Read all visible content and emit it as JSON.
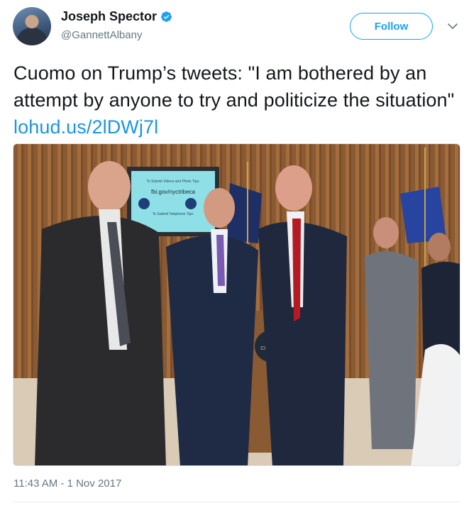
{
  "author": {
    "name": "Joseph Spector",
    "handle": "@GannettAlbany",
    "verified": true
  },
  "follow_label": "Follow",
  "icons": {
    "verified": "verified-badge-icon",
    "caret": "chevron-down-icon"
  },
  "tweet": {
    "text": "Cuomo on Trump’s tweets: \"I am bothered by an attempt by anyone to try and politicize the situation\"",
    "link": "lohud.us/2lDWj7l"
  },
  "photo": {
    "screen_text_1": "To Submit Videos and Photo Tips:",
    "screen_text_2": "fbi.gov/nyctribeca",
    "screen_text_3": "To Submit Telephone Tips:",
    "seal_text": "CITY OF"
  },
  "timestamp": "11:43 AM - 1 Nov 2017",
  "colors": {
    "accent": "#1da1f2",
    "link": "#1b95e0",
    "muted": "#657786"
  }
}
